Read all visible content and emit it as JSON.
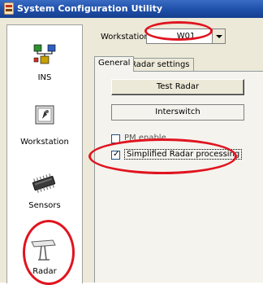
{
  "window": {
    "title": "System Configuration Utility"
  },
  "sidebar": {
    "items": [
      {
        "label": "INS",
        "icon": "network-icon"
      },
      {
        "label": "Workstation",
        "icon": "workstation-icon"
      },
      {
        "label": "Sensors",
        "icon": "sensor-chip-icon"
      },
      {
        "label": "Radar",
        "icon": "radar-dish-icon"
      }
    ]
  },
  "workstation": {
    "label": "Workstation",
    "selected": "W01"
  },
  "tabs": [
    {
      "label": "General"
    },
    {
      "label": "Radar settings"
    }
  ],
  "general": {
    "test_radar_label": "Test Radar",
    "interswitch_label": "Interswitch",
    "pm_enable_label": "PM enable",
    "pm_enable_checked": false,
    "simplified_label": "Simplified Radar processing",
    "simplified_checked": true,
    "check_mark": "✓"
  },
  "colors": {
    "highlight_oval": "#e0141f",
    "titlebar": "#1e4fa8",
    "panel": "#ece9d8"
  }
}
